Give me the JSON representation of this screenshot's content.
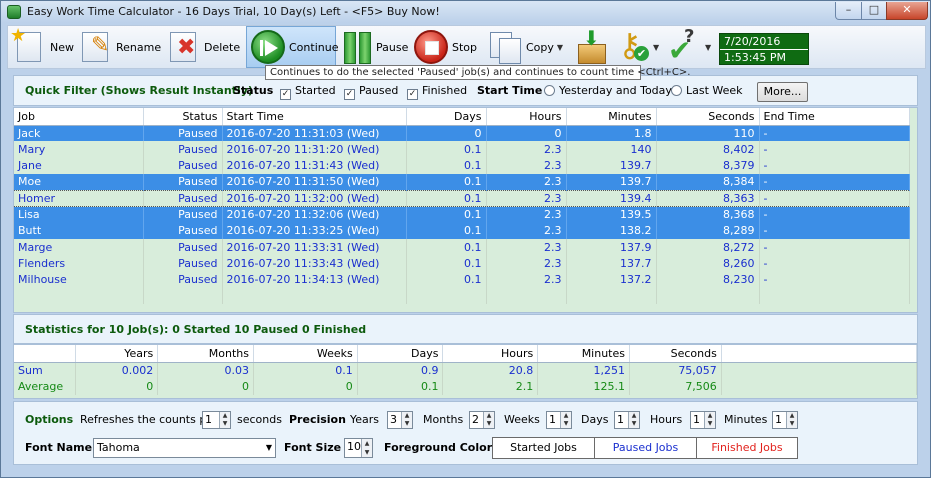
{
  "window": {
    "title": "Easy Work Time Calculator - 16 Days Trial, 10 Day(s) Left  - <F5> Buy Now!",
    "min": "–",
    "max": "□",
    "close": "✕"
  },
  "toolbar": {
    "new": "New",
    "rename": "Rename",
    "delete": "Delete",
    "continue": "Continue",
    "pause": "Pause",
    "stop": "Stop",
    "copy": "Copy",
    "date": "7/20/2016",
    "time": "1:53:45 PM"
  },
  "tooltip": "Continues to do the selected 'Paused' job(s) and continues to count time <Ctrl+C>.",
  "filter": {
    "title": "Quick Filter (Shows Result Instantly)",
    "status_label": "Status",
    "started": "Started",
    "paused": "Paused",
    "finished": "Finished",
    "start_time_label": "Start Time",
    "yesterday_today": "Yesterday and Today",
    "last_week": "Last Week",
    "more": "More..."
  },
  "grid": {
    "columns": [
      "Job",
      "Status",
      "Start Time",
      "Days",
      "Hours",
      "Minutes",
      "Seconds",
      "End Time"
    ],
    "rows": [
      {
        "job": "Jack",
        "status": "Paused",
        "start": "2016-07-20 11:31:03 (Wed)",
        "days": "0",
        "hours": "0",
        "minutes": "1.8",
        "seconds": "110",
        "end": "-",
        "selected": true
      },
      {
        "job": "Mary",
        "status": "Paused",
        "start": "2016-07-20 11:31:20 (Wed)",
        "days": "0.1",
        "hours": "2.3",
        "minutes": "140",
        "seconds": "8,402",
        "end": "-",
        "selected": false
      },
      {
        "job": "Jane",
        "status": "Paused",
        "start": "2016-07-20 11:31:43 (Wed)",
        "days": "0.1",
        "hours": "2.3",
        "minutes": "139.7",
        "seconds": "8,379",
        "end": "-",
        "selected": false
      },
      {
        "job": "Moe",
        "status": "Paused",
        "start": "2016-07-20 11:31:50 (Wed)",
        "days": "0.1",
        "hours": "2.3",
        "minutes": "139.7",
        "seconds": "8,384",
        "end": "-",
        "selected": true
      },
      {
        "job": "Homer",
        "status": "Paused",
        "start": "2016-07-20 11:32:00 (Wed)",
        "days": "0.1",
        "hours": "2.3",
        "minutes": "139.4",
        "seconds": "8,363",
        "end": "-",
        "selected": false,
        "focus": true
      },
      {
        "job": "Lisa",
        "status": "Paused",
        "start": "2016-07-20 11:32:06 (Wed)",
        "days": "0.1",
        "hours": "2.3",
        "minutes": "139.5",
        "seconds": "8,368",
        "end": "-",
        "selected": true
      },
      {
        "job": "Butt",
        "status": "Paused",
        "start": "2016-07-20 11:33:25 (Wed)",
        "days": "0.1",
        "hours": "2.3",
        "minutes": "138.2",
        "seconds": "8,289",
        "end": "-",
        "selected": true
      },
      {
        "job": "Marge",
        "status": "Paused",
        "start": "2016-07-20 11:33:31 (Wed)",
        "days": "0.1",
        "hours": "2.3",
        "minutes": "137.9",
        "seconds": "8,272",
        "end": "-",
        "selected": false
      },
      {
        "job": "Flenders",
        "status": "Paused",
        "start": "2016-07-20 11:33:43 (Wed)",
        "days": "0.1",
        "hours": "2.3",
        "minutes": "137.7",
        "seconds": "8,260",
        "end": "-",
        "selected": false
      },
      {
        "job": "Milhouse",
        "status": "Paused",
        "start": "2016-07-20 11:34:13 (Wed)",
        "days": "0.1",
        "hours": "2.3",
        "minutes": "137.2",
        "seconds": "8,230",
        "end": "-",
        "selected": false
      }
    ]
  },
  "statistics": {
    "summary": "Statistics for 10 Job(s): 0 Started 10 Paused 0 Finished",
    "columns": [
      "Years",
      "Months",
      "Weeks",
      "Days",
      "Hours",
      "Minutes",
      "Seconds"
    ],
    "sum": {
      "label": "Sum",
      "values": [
        "0.002",
        "0.03",
        "0.1",
        "0.9",
        "20.8",
        "1,251",
        "75,057"
      ]
    },
    "average": {
      "label": "Average",
      "values": [
        "0",
        "0",
        "0",
        "0.1",
        "2.1",
        "125.1",
        "7,506"
      ]
    }
  },
  "options": {
    "title": "Options",
    "refresh_label": "Refreshes the counts per",
    "refresh_value": "1",
    "seconds_label": "seconds",
    "precision_label": "Precision",
    "years_label": "Years",
    "years_value": "3",
    "months_label": "Months",
    "months_value": "2",
    "weeks_label": "Weeks",
    "weeks_value": "1",
    "days_label": "Days",
    "days_value": "1",
    "hours_label": "Hours",
    "hours_value": "1",
    "minutes_label": "Minutes",
    "minutes_value": "1",
    "font_name_label": "Font Name",
    "font_name_value": "Tahoma",
    "font_size_label": "Font Size",
    "font_size_value": "10",
    "fg_colors_label": "Foreground Colors",
    "started_jobs": "Started Jobs",
    "paused_jobs": "Paused Jobs",
    "finished_jobs": "Finished Jobs"
  },
  "colors": {
    "paused_text": "#1a2fcf",
    "finished_text": "#e2211c",
    "started_text": "#000000",
    "selection": "#3c8ee6",
    "grid_bg": "#d8eddb",
    "section_title": "#0c5a0c"
  }
}
